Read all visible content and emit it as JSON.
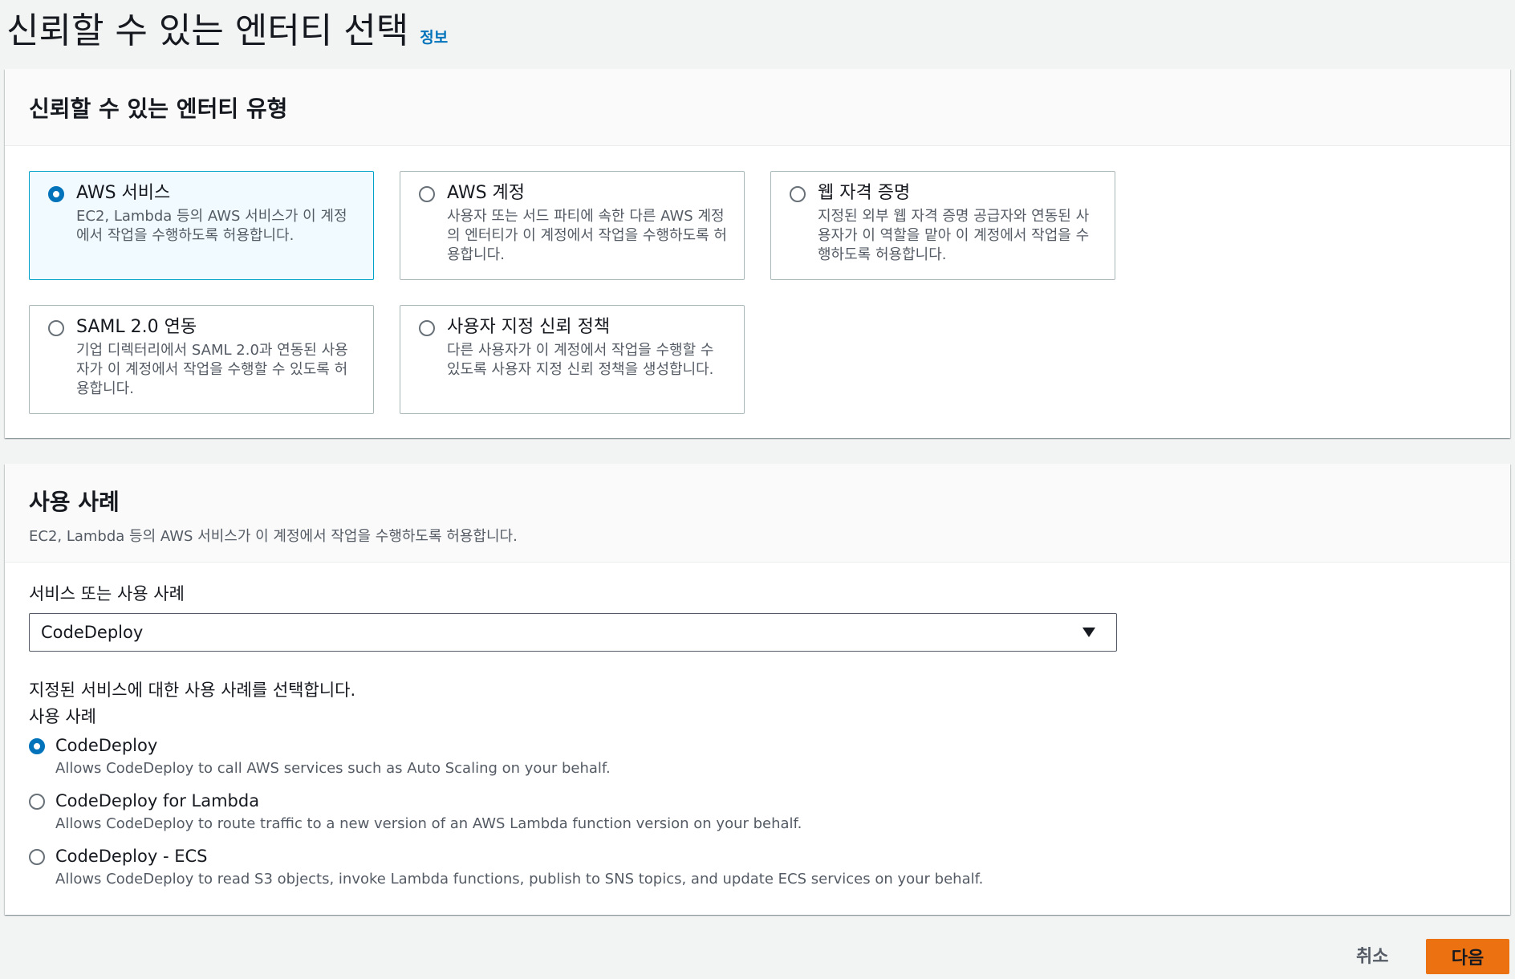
{
  "page": {
    "title": "신뢰할 수 있는 엔터티 선택",
    "info_link": "정보"
  },
  "trusted_entity": {
    "title": "신뢰할 수 있는 엔터티 유형",
    "options": [
      {
        "label": "AWS 서비스",
        "desc": "EC2, Lambda 등의 AWS 서비스가 이 계정에서 작업을 수행하도록 허용합니다.",
        "selected": true
      },
      {
        "label": "AWS 계정",
        "desc": "사용자 또는 서드 파티에 속한 다른 AWS 계정의 엔터티가 이 계정에서 작업을 수행하도록 허용합니다.",
        "selected": false
      },
      {
        "label": "웹 자격 증명",
        "desc": "지정된 외부 웹 자격 증명 공급자와 연동된 사용자가 이 역할을 맡아 이 계정에서 작업을 수행하도록 허용합니다.",
        "selected": false
      },
      {
        "label": "SAML 2.0 연동",
        "desc": "기업 디렉터리에서 SAML 2.0과 연동된 사용자가 이 계정에서 작업을 수행할 수 있도록 허용합니다.",
        "selected": false
      },
      {
        "label": "사용자 지정 신뢰 정책",
        "desc": "다른 사용자가 이 계정에서 작업을 수행할 수 있도록 사용자 지정 신뢰 정책을 생성합니다.",
        "selected": false
      }
    ]
  },
  "use_case": {
    "title": "사용 사례",
    "description": "EC2, Lambda 등의 AWS 서비스가 이 계정에서 작업을 수행하도록 허용합니다.",
    "select_label": "서비스 또는 사용 사례",
    "select_value": "CodeDeploy",
    "help_text": "지정된 서비스에 대한 사용 사례를 선택합니다.",
    "group_label": "사용 사례",
    "options": [
      {
        "label": "CodeDeploy",
        "desc": "Allows CodeDeploy to call AWS services such as Auto Scaling on your behalf.",
        "selected": true
      },
      {
        "label": "CodeDeploy for Lambda",
        "desc": "Allows CodeDeploy to route traffic to a new version of an AWS Lambda function version on your behalf.",
        "selected": false
      },
      {
        "label": "CodeDeploy - ECS",
        "desc": "Allows CodeDeploy to read S3 objects, invoke Lambda functions, publish to SNS topics, and update ECS services on your behalf.",
        "selected": false
      }
    ]
  },
  "footer": {
    "cancel_label": "취소",
    "next_label": "다음"
  },
  "colors": {
    "accent": "#0073bb",
    "primary_button": "#ec7211",
    "selected_tile_bg": "#f1faff",
    "selected_tile_border": "#00a1c9"
  }
}
